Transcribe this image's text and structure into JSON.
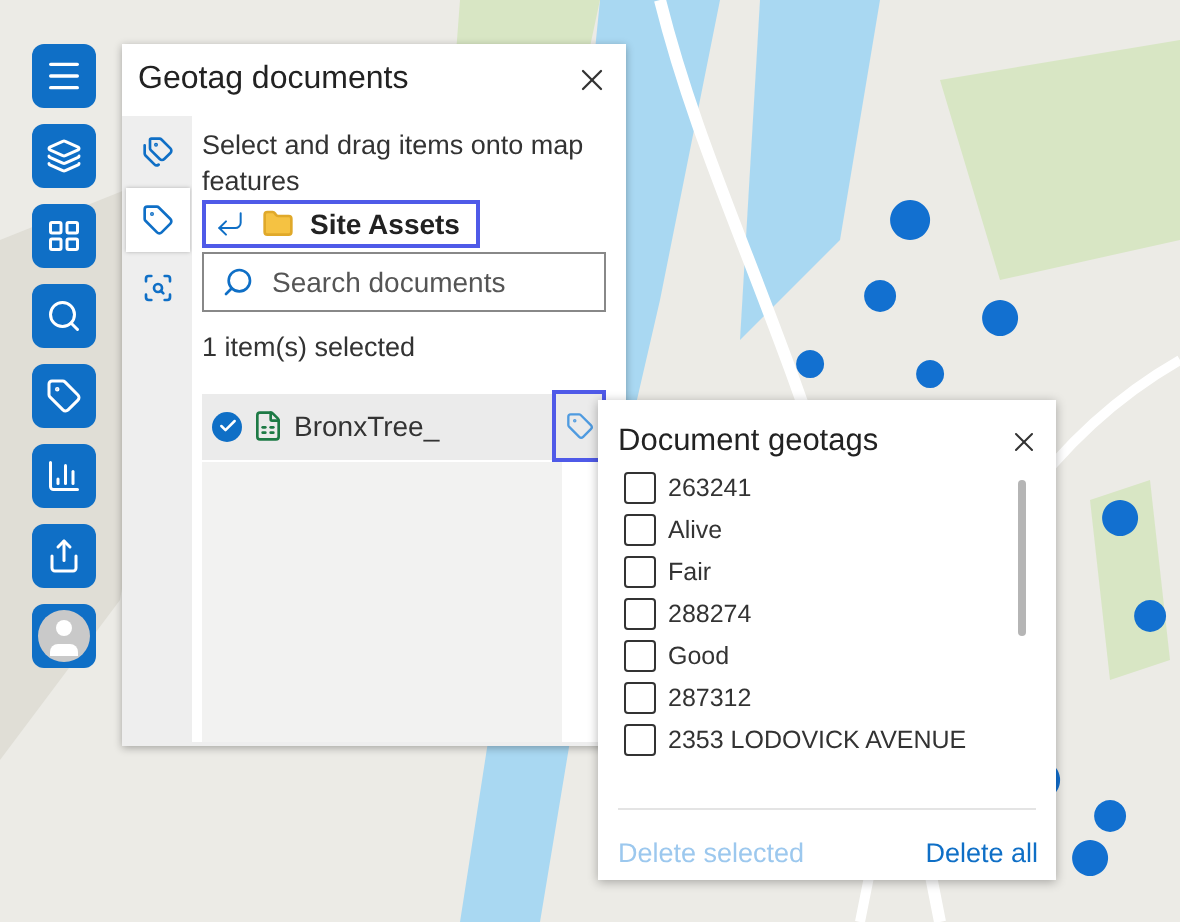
{
  "toolbar": {
    "buttons": [
      {
        "kind": "menu"
      },
      {
        "kind": "layers"
      },
      {
        "kind": "grid"
      },
      {
        "kind": "search"
      },
      {
        "kind": "tag"
      },
      {
        "kind": "chart"
      },
      {
        "kind": "share"
      },
      {
        "kind": "avatar"
      }
    ]
  },
  "geotag_panel": {
    "title": "Geotag documents",
    "tabs": [
      {
        "kind": "document-tag",
        "selected": false
      },
      {
        "kind": "tag",
        "selected": true
      },
      {
        "kind": "search-stack",
        "selected": false
      }
    ],
    "instruction": "Select and drag items onto map features",
    "breadcrumb": {
      "folder": "Site Assets",
      "highlighted": true
    },
    "search": {
      "placeholder": "Search documents"
    },
    "selection_count": "1 item(s) selected",
    "items": [
      {
        "name": "BronxTree_",
        "checked": true,
        "tag_highlighted": true
      }
    ]
  },
  "geotags_popup": {
    "title": "Document geotags",
    "tags": [
      {
        "label": "263241",
        "checked": false
      },
      {
        "label": "Alive",
        "checked": false
      },
      {
        "label": "Fair",
        "checked": false
      },
      {
        "label": "288274",
        "checked": false
      },
      {
        "label": "Good",
        "checked": false
      },
      {
        "label": "287312",
        "checked": false
      },
      {
        "label": "2353 LODOVICK AVENUE",
        "checked": false
      }
    ],
    "buttons": [
      {
        "label": "Delete selected",
        "disabled": true
      },
      {
        "label": "Delete all",
        "disabled": false
      }
    ]
  }
}
